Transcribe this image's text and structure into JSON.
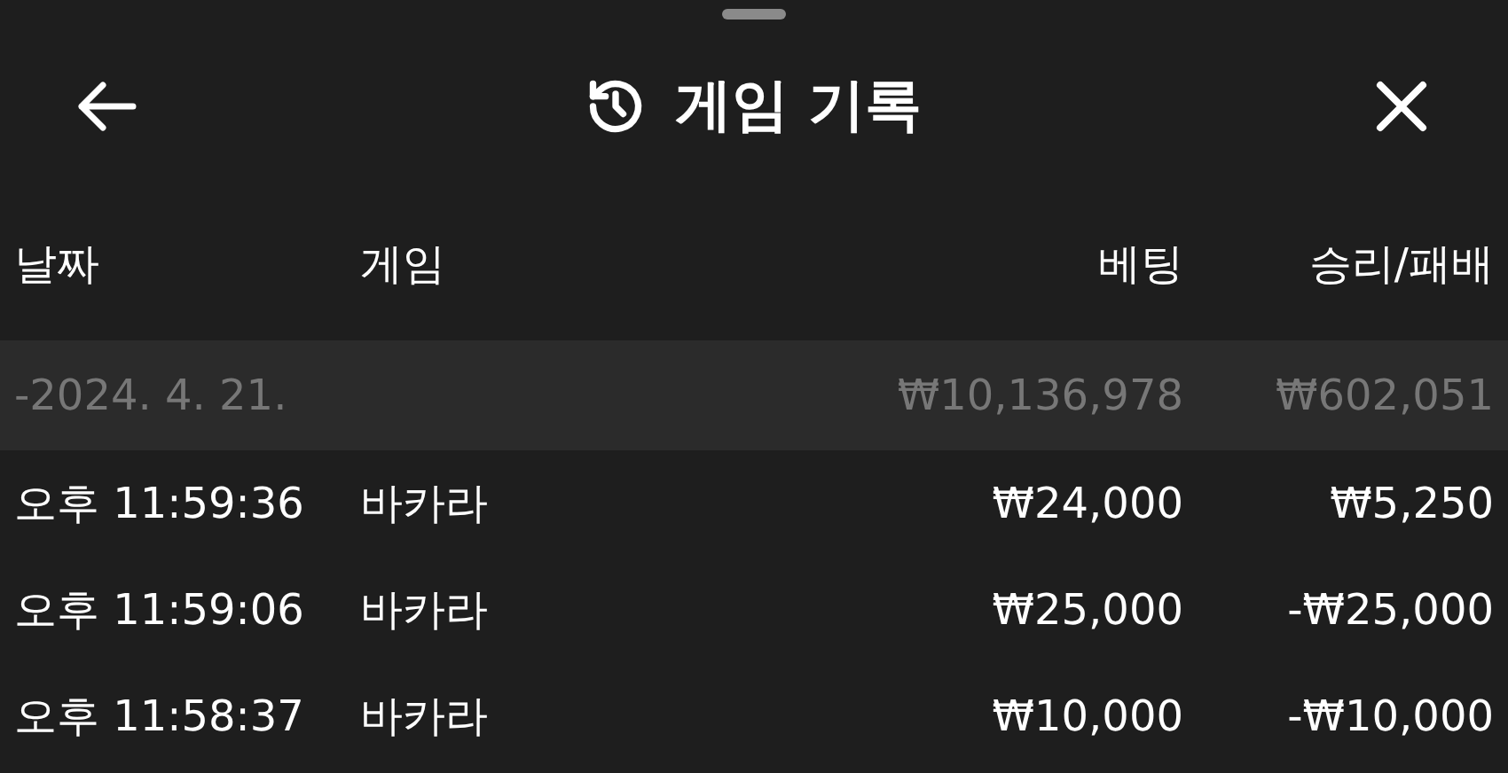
{
  "title": "게임 기록",
  "columns": [
    "날짜",
    "게임",
    "베팅",
    "승리/패배"
  ],
  "group": {
    "date": "-2024. 4. 21.",
    "bet": "₩10,136,978",
    "result": "₩602,051"
  },
  "rows": [
    {
      "time": "오후 11:59:36",
      "game": "바카라",
      "bet": "₩24,000",
      "result": "₩5,250"
    },
    {
      "time": "오후 11:59:06",
      "game": "바카라",
      "bet": "₩25,000",
      "result": "-₩25,000"
    },
    {
      "time": "오후 11:58:37",
      "game": "바카라",
      "bet": "₩10,000",
      "result": "-₩10,000"
    }
  ]
}
